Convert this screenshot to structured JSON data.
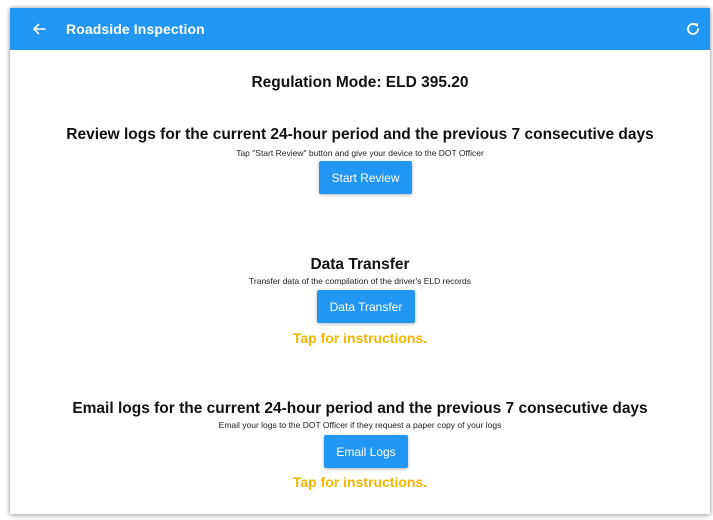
{
  "appbar": {
    "title": "Roadside Inspection",
    "back_icon": "arrow-left-icon",
    "refresh_icon": "refresh-icon",
    "color": "#2196f3"
  },
  "regulation": {
    "text": "Regulation Mode: ELD 395.20"
  },
  "review": {
    "heading": "Review logs for the current 24-hour period and the previous 7 consecutive days",
    "subtext": "Tap \"Start Review\" button and give your device to the DOT Officer",
    "button_label": "Start Review"
  },
  "data_transfer": {
    "heading": "Data Transfer",
    "subtext": "Transfer data of the compilation of the driver's ELD records",
    "button_label": "Data Transfer",
    "link_label": "Tap for instructions."
  },
  "email": {
    "heading": "Email logs for the current 24-hour period and the previous 7 consecutive days",
    "subtext": "Email your logs to the DOT Officer if they request a paper copy of your logs",
    "button_label": "Email Logs",
    "link_label": "Tap for instructions."
  },
  "colors": {
    "accent": "#2196f3",
    "link": "#f4b400"
  }
}
